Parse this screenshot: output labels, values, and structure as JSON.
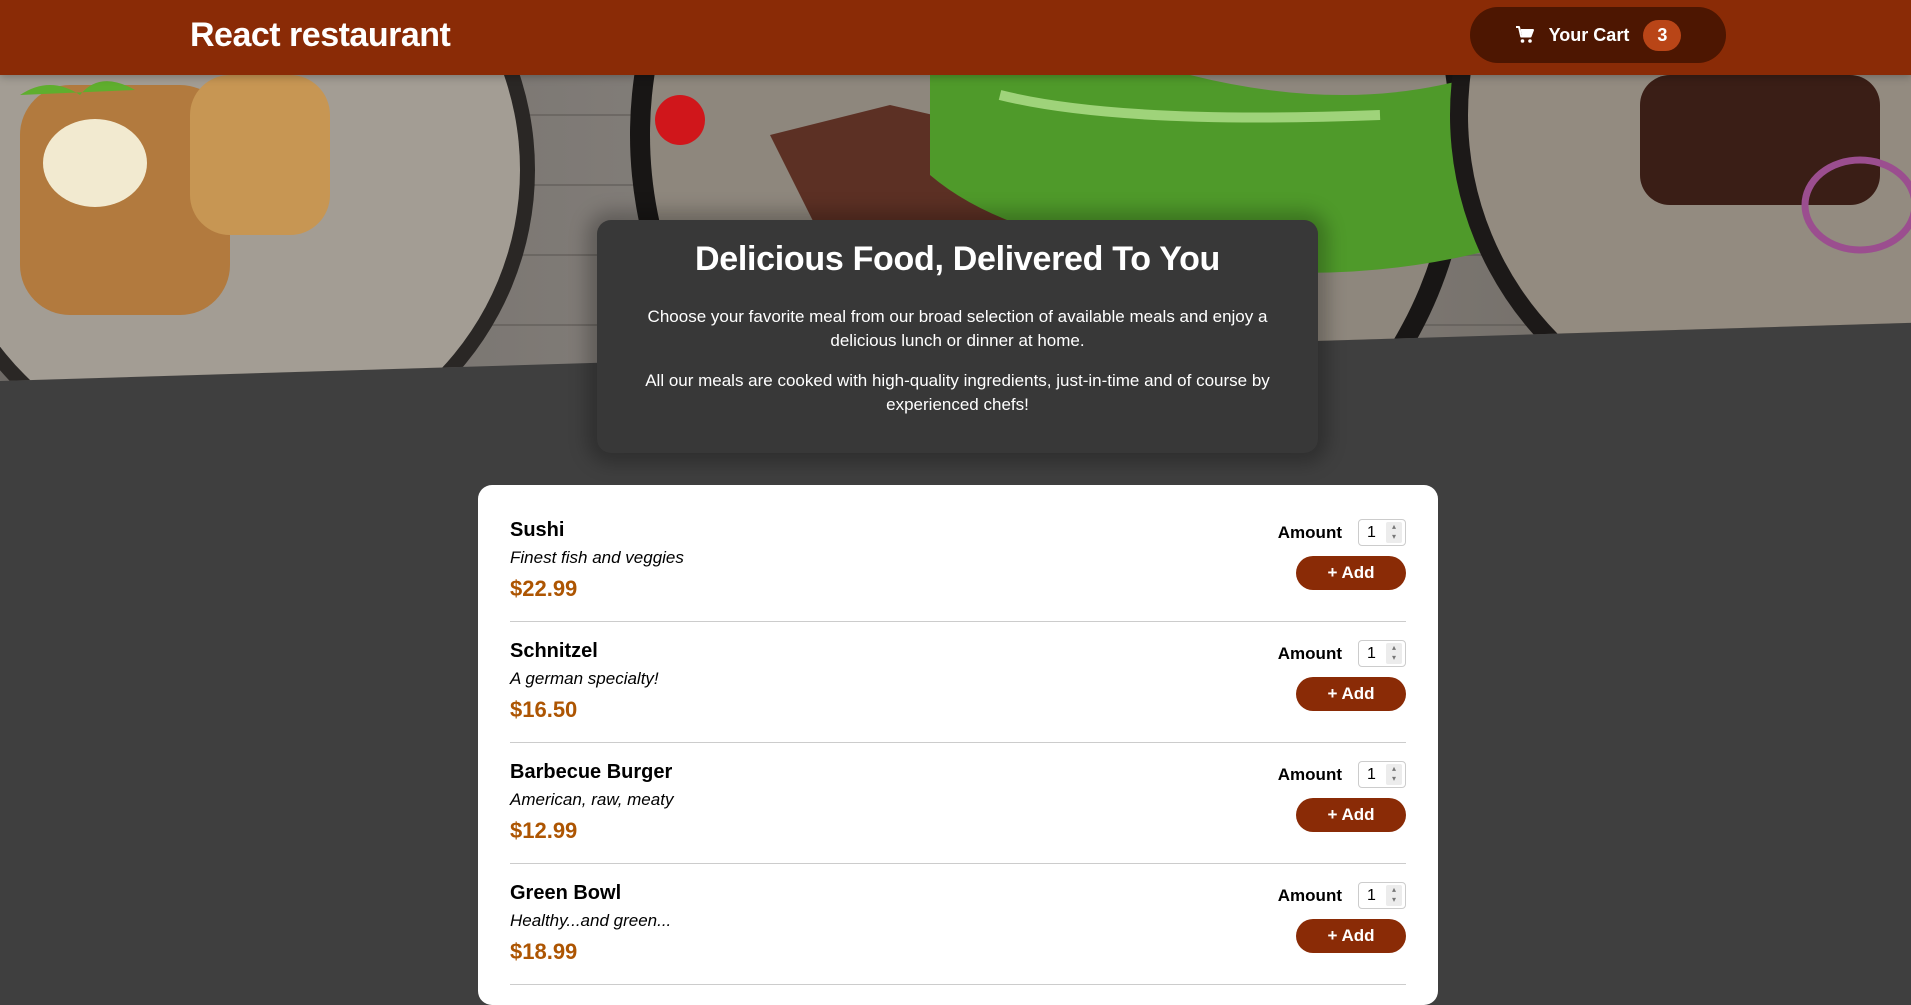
{
  "header": {
    "brand": "React restaurant",
    "cart_label": "Your Cart",
    "cart_count": "3"
  },
  "summary": {
    "title": "Delicious Food, Delivered To You",
    "paragraph1": "Choose your favorite meal from our broad selection of available meals and enjoy a delicious lunch or dinner at home.",
    "paragraph2": "All our meals are cooked with high-quality ingredients, just-in-time and of course by experienced chefs!"
  },
  "meals": [
    {
      "name": "Sushi",
      "description": "Finest fish and veggies",
      "price": "$22.99",
      "amount_label": "Amount",
      "amount": "1",
      "add_label": "+ Add"
    },
    {
      "name": "Schnitzel",
      "description": "A german specialty!",
      "price": "$16.50",
      "amount_label": "Amount",
      "amount": "1",
      "add_label": "+ Add"
    },
    {
      "name": "Barbecue Burger",
      "description": "American, raw, meaty",
      "price": "$12.99",
      "amount_label": "Amount",
      "amount": "1",
      "add_label": "+ Add"
    },
    {
      "name": "Green Bowl",
      "description": "Healthy...and green...",
      "price": "$18.99",
      "amount_label": "Amount",
      "amount": "1",
      "add_label": "+ Add"
    }
  ],
  "colors": {
    "header": "#8a2b06",
    "cart_button": "#4d1601",
    "badge": "#b94517",
    "price": "#ad5502",
    "background": "#3f3f3f"
  },
  "icons": {
    "cart": "shopping-cart-icon"
  }
}
